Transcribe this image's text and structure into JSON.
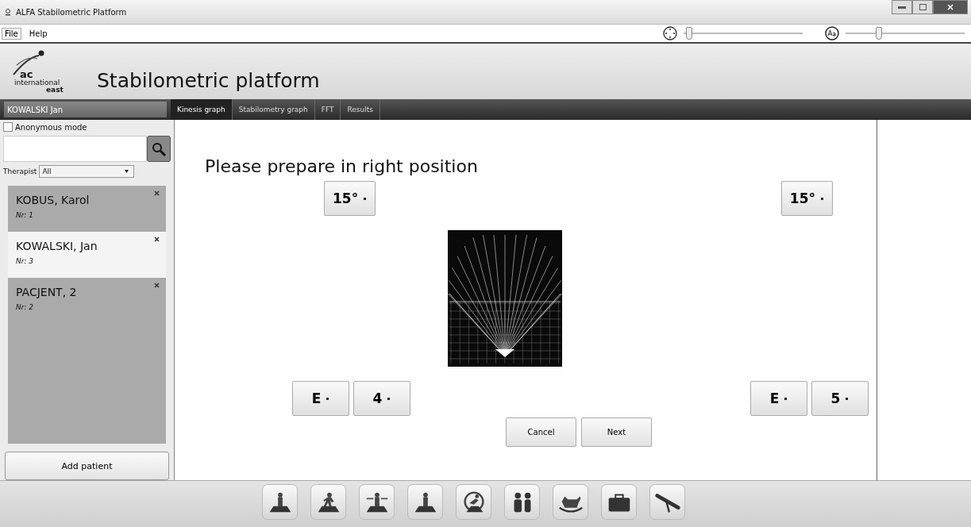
{
  "window": {
    "title": "ALFA Stabilometric Platform"
  },
  "menu": [
    {
      "label": "File",
      "selected": true
    },
    {
      "label": "Help",
      "selected": false
    }
  ],
  "zoom_slider": {
    "level": 0.02
  },
  "font_slider": {
    "level": 0.27
  },
  "header": {
    "logo_lines": [
      "ac",
      "international",
      "east"
    ],
    "title": "Stabilometric platform"
  },
  "current_patient": "KOWALSKI Jan",
  "tabs": [
    {
      "label": "Kinesis graph",
      "selected": true
    },
    {
      "label": "Stabilometry graph",
      "selected": false
    },
    {
      "label": "FFT",
      "selected": false
    },
    {
      "label": "Results",
      "selected": false
    }
  ],
  "sidebar": {
    "anonymous_mode": {
      "label": "Anonymous mode",
      "checked": false
    },
    "therapist": {
      "label": "Therapist",
      "value": "All"
    },
    "patients": [
      {
        "name": "KOBUS, Karol",
        "number": "Nr: 1",
        "selected": false
      },
      {
        "name": "KOWALSKI, Jan",
        "number": "Nr: 3",
        "selected": true
      },
      {
        "name": "PACJENT, 2",
        "number": "Nr: 2",
        "selected": false
      }
    ],
    "add_button": "Add patient"
  },
  "main": {
    "instruction": "Please prepare in right position",
    "left_angle": "15°",
    "right_angle": "15°",
    "left_feet": [
      "E",
      "4"
    ],
    "right_feet": [
      "E",
      "5"
    ],
    "buttons": [
      "Cancel",
      "Next"
    ]
  }
}
